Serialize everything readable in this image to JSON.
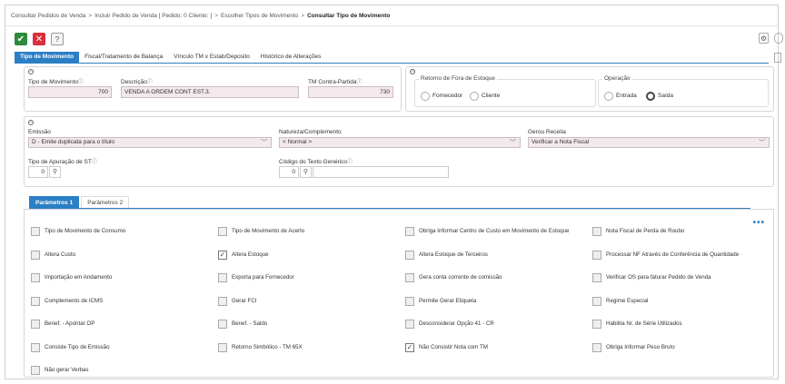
{
  "breadcrumb": {
    "items": [
      "Consultar Pedidos de Venda",
      "Incluir Pedido de Venda [ Pedido: 0 Cliente: ]",
      "Escolher Tipos de Movimento"
    ],
    "current": "Consultar Tipo de Movimento",
    "separator": ">"
  },
  "toolbar": {
    "confirm_icon": "check-icon",
    "cancel_icon": "close-icon",
    "help_label": "?",
    "settings_icon": "gear-icon",
    "confirm_glyph": "✔",
    "cancel_glyph": "✕",
    "gear_glyph": "⚙"
  },
  "tabs": [
    {
      "label": "Tipo de Movimento",
      "active": true
    },
    {
      "label": "Fiscal/Tratamento de Balança",
      "active": false
    },
    {
      "label": "Vínculo TM x Estab/Deposito",
      "active": false
    },
    {
      "label": "Histórico de Alterações",
      "active": false
    }
  ],
  "main_panel": {
    "tipo_movimento": {
      "label": "Tipo de Movimento",
      "value": "700"
    },
    "descricao": {
      "label": "Descrição",
      "value": "VENDA A ORDEM CONT EST.3."
    },
    "tm_contra_partida": {
      "label": "TM Contra-Partida",
      "value": "730"
    },
    "info_glyph": "ⓘ"
  },
  "retorno_estoque": {
    "legend": "Retorno de Fora de Estoque",
    "options": [
      {
        "label": "Fornecedor",
        "selected": false
      },
      {
        "label": "Cliente",
        "selected": false
      }
    ]
  },
  "operacao": {
    "legend": "Operação",
    "options": [
      {
        "label": "Entrada",
        "selected": false
      },
      {
        "label": "Saída",
        "selected": true
      }
    ]
  },
  "second_panel": {
    "emissao": {
      "label": "Emissão",
      "value": "D - Emite duplicata para o título"
    },
    "natureza": {
      "label": "Natureza/Complemento",
      "value": "< Normal >"
    },
    "gerou_receita": {
      "label": "Gerou Receita",
      "value": "Verificar a Nota Fiscal"
    },
    "tipo_apuracao": {
      "label": "Tipo de Apuração de ST",
      "value": "0"
    },
    "codigo_texto": {
      "label": "Código do Texto Genérico",
      "value": "0"
    },
    "chevron": "﹀",
    "search_glyph": "🔍"
  },
  "param_tabs": [
    {
      "label": "Parâmetros 1",
      "active": true
    },
    {
      "label": "Parâmetros 2",
      "active": false
    }
  ],
  "more_label": "•••",
  "checkboxes": [
    [
      {
        "label": "Tipo de Movimento de Consumo",
        "checked": false
      },
      {
        "label": "Tipo de Movimento de Acerto",
        "checked": false
      },
      {
        "label": "Obriga Informar Centro de Custo em Movimento de Estoque",
        "checked": false
      },
      {
        "label": "Nota Fiscal de Perda de Roubo",
        "checked": false
      }
    ],
    [
      {
        "label": "Altera Custo",
        "checked": false
      },
      {
        "label": "Altera Estoque",
        "checked": true
      },
      {
        "label": "Altera Estoque de Terceiros",
        "checked": false
      },
      {
        "label": "Processar NF Através de Conferência de Quantidade",
        "checked": false
      }
    ],
    [
      {
        "label": "Importação em Andamento",
        "checked": false
      },
      {
        "label": "Exporta para Fornecedor",
        "checked": false
      },
      {
        "label": "Gera conta corrente de comissão",
        "checked": false
      },
      {
        "label": "Verificar OS para faturar Pedido de Venda",
        "checked": false
      }
    ],
    [
      {
        "label": "Complemento de ICMS",
        "checked": false
      },
      {
        "label": "Gerar FCI",
        "checked": false
      },
      {
        "label": "Permite Gerar Etiqueta",
        "checked": false
      },
      {
        "label": "Regime Especial",
        "checked": false
      }
    ],
    [
      {
        "label": "Benef. - Apontar OP",
        "checked": false
      },
      {
        "label": "Benef. - Saldo",
        "checked": false
      },
      {
        "label": "Desconsiderar Opção 41 - CR",
        "checked": false
      },
      {
        "label": "Habilita Nr. de Série Utilizados",
        "checked": false
      }
    ],
    [
      {
        "label": "Consiste Tipo de Emissão",
        "checked": false
      },
      {
        "label": "Retorno Simbólico - TM 65X",
        "checked": false
      },
      {
        "label": "Não Consistir Nota com TM",
        "checked": true
      },
      {
        "label": "Obriga Informar Peso Bruto",
        "checked": false
      }
    ],
    [
      {
        "label": "Não gerar Verbas",
        "checked": false
      }
    ]
  ]
}
